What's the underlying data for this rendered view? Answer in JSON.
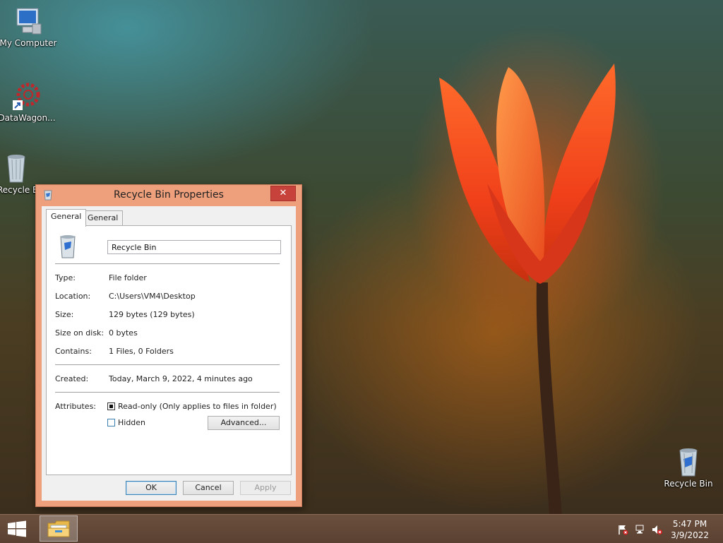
{
  "desktop": {
    "icons": [
      {
        "label": "My Computer"
      },
      {
        "label": "DataWagon..."
      },
      {
        "label": "Recycle Bin"
      },
      {
        "label": "Recycle Bin"
      }
    ]
  },
  "dialog": {
    "title": "Recycle Bin Properties",
    "close_label": "✕",
    "tabs": [
      {
        "label": "General"
      },
      {
        "label": "General"
      }
    ],
    "name_value": "Recycle Bin",
    "properties": [
      {
        "label": "Type:",
        "value": "File folder"
      },
      {
        "label": "Location:",
        "value": "C:\\Users\\VM4\\Desktop"
      },
      {
        "label": "Size:",
        "value": "129 bytes (129 bytes)"
      },
      {
        "label": "Size on disk:",
        "value": "0 bytes"
      },
      {
        "label": "Contains:",
        "value": "1 Files, 0 Folders"
      }
    ],
    "created": {
      "label": "Created:",
      "value": "Today, March 9, 2022, 4 minutes ago"
    },
    "attributes": {
      "label": "Attributes:",
      "readonly_label": "Read-only (Only applies to files in folder)",
      "hidden_label": "Hidden",
      "advanced_label": "Advanced..."
    },
    "buttons": {
      "ok": "OK",
      "cancel": "Cancel",
      "apply": "Apply"
    }
  },
  "taskbar": {
    "time": "5:47 PM",
    "date": "3/9/2022"
  },
  "colors": {
    "dialog_frame": "#eea07c",
    "close_button": "#c7423a",
    "taskbar": "#5a4131"
  }
}
